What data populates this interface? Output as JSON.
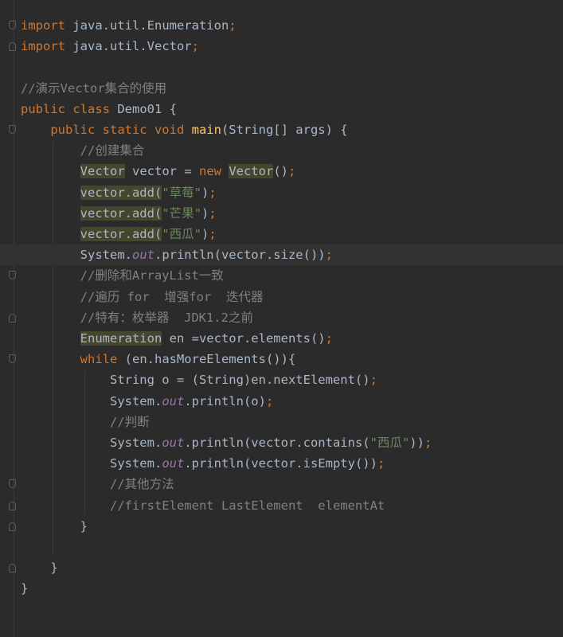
{
  "editor": {
    "language": "java",
    "current_line": 12,
    "colors": {
      "background": "#2b2b2b",
      "current_line": "#323232",
      "keyword": "#cc7832",
      "comment": "#808080",
      "string": "#6a8759",
      "method_declaration": "#ffc66d",
      "static_field": "#9876aa",
      "default_text": "#a9b7c6",
      "highlighted_usage": "#4a4a33"
    },
    "lines": [
      {
        "n": 1,
        "fold": "open",
        "tokens": [
          {
            "t": "kw",
            "v": "import"
          },
          {
            "t": "plain",
            "v": " java.util.Enumeration"
          },
          {
            "t": "kw",
            "v": ";"
          }
        ]
      },
      {
        "n": 2,
        "fold": "close",
        "tokens": [
          {
            "t": "kw",
            "v": "import"
          },
          {
            "t": "plain",
            "v": " java.util.Vector"
          },
          {
            "t": "kw",
            "v": ";"
          }
        ]
      },
      {
        "n": 3,
        "fold": "",
        "tokens": []
      },
      {
        "n": 4,
        "fold": "",
        "tokens": [
          {
            "t": "cmt",
            "v": "//演示Vector集合的使用"
          }
        ]
      },
      {
        "n": 5,
        "fold": "",
        "tokens": [
          {
            "t": "kw",
            "v": "public class "
          },
          {
            "t": "plain",
            "v": "Demo01 {"
          }
        ]
      },
      {
        "n": 6,
        "fold": "open",
        "tokens": [
          {
            "t": "plain",
            "v": "    "
          },
          {
            "t": "kw",
            "v": "public static void "
          },
          {
            "t": "fn",
            "v": "main"
          },
          {
            "t": "plain",
            "v": "(String[] args) {"
          }
        ]
      },
      {
        "n": 7,
        "fold": "",
        "tokens": [
          {
            "t": "plain",
            "v": "        "
          },
          {
            "t": "cmt",
            "v": "//创建集合"
          }
        ]
      },
      {
        "n": 8,
        "fold": "",
        "tokens": [
          {
            "t": "plain",
            "v": "        "
          },
          {
            "t": "hl",
            "v": "Vector"
          },
          {
            "t": "plain",
            "v": " vector = "
          },
          {
            "t": "kw",
            "v": "new "
          },
          {
            "t": "hl",
            "v": "Vector"
          },
          {
            "t": "plain",
            "v": "()"
          },
          {
            "t": "kw",
            "v": ";"
          }
        ]
      },
      {
        "n": 9,
        "fold": "",
        "tokens": [
          {
            "t": "plain",
            "v": "        "
          },
          {
            "t": "hl",
            "v": "vector.add("
          },
          {
            "t": "str",
            "v": "\"草莓\""
          },
          {
            "t": "plain",
            "v": ")"
          },
          {
            "t": "kw",
            "v": ";"
          }
        ]
      },
      {
        "n": 10,
        "fold": "",
        "tokens": [
          {
            "t": "plain",
            "v": "        "
          },
          {
            "t": "hl",
            "v": "vector.add("
          },
          {
            "t": "str",
            "v": "\"芒果\""
          },
          {
            "t": "plain",
            "v": ")"
          },
          {
            "t": "kw",
            "v": ";"
          }
        ]
      },
      {
        "n": 11,
        "fold": "",
        "tokens": [
          {
            "t": "plain",
            "v": "        "
          },
          {
            "t": "hl",
            "v": "vector.add("
          },
          {
            "t": "str",
            "v": "\"西瓜\""
          },
          {
            "t": "plain",
            "v": ")"
          },
          {
            "t": "kw",
            "v": ";"
          }
        ]
      },
      {
        "n": 12,
        "fold": "",
        "tokens": [
          {
            "t": "plain",
            "v": "        System."
          },
          {
            "t": "static",
            "v": "out"
          },
          {
            "t": "plain",
            "v": ".println(vector.size())"
          },
          {
            "t": "kw",
            "v": ";"
          }
        ]
      },
      {
        "n": 13,
        "fold": "open",
        "tokens": [
          {
            "t": "plain",
            "v": "        "
          },
          {
            "t": "cmt",
            "v": "//删除和ArrayList一致"
          }
        ]
      },
      {
        "n": 14,
        "fold": "",
        "tokens": [
          {
            "t": "plain",
            "v": "        "
          },
          {
            "t": "cmt",
            "v": "//遍历 for  增强for  迭代器"
          }
        ]
      },
      {
        "n": 15,
        "fold": "close",
        "tokens": [
          {
            "t": "plain",
            "v": "        "
          },
          {
            "t": "cmt",
            "v": "//特有：枚举器  JDK1.2之前"
          }
        ]
      },
      {
        "n": 16,
        "fold": "",
        "tokens": [
          {
            "t": "plain",
            "v": "        "
          },
          {
            "t": "hl",
            "v": "Enumeration"
          },
          {
            "t": "plain",
            "v": " en =vector.elements()"
          },
          {
            "t": "kw",
            "v": ";"
          }
        ]
      },
      {
        "n": 17,
        "fold": "open",
        "tokens": [
          {
            "t": "plain",
            "v": "        "
          },
          {
            "t": "kw",
            "v": "while "
          },
          {
            "t": "plain",
            "v": "(en.hasMoreElements()){"
          }
        ]
      },
      {
        "n": 18,
        "fold": "",
        "tokens": [
          {
            "t": "plain",
            "v": "            String o = (String)en.nextElement()"
          },
          {
            "t": "kw",
            "v": ";"
          }
        ]
      },
      {
        "n": 19,
        "fold": "",
        "tokens": [
          {
            "t": "plain",
            "v": "            System."
          },
          {
            "t": "static",
            "v": "out"
          },
          {
            "t": "plain",
            "v": ".println(o)"
          },
          {
            "t": "kw",
            "v": ";"
          }
        ]
      },
      {
        "n": 20,
        "fold": "",
        "tokens": [
          {
            "t": "plain",
            "v": "            "
          },
          {
            "t": "cmt",
            "v": "//判断"
          }
        ]
      },
      {
        "n": 21,
        "fold": "",
        "tokens": [
          {
            "t": "plain",
            "v": "            System."
          },
          {
            "t": "static",
            "v": "out"
          },
          {
            "t": "plain",
            "v": ".println(vector.contains("
          },
          {
            "t": "str",
            "v": "\"西瓜\""
          },
          {
            "t": "plain",
            "v": "))"
          },
          {
            "t": "kw",
            "v": ";"
          }
        ]
      },
      {
        "n": 22,
        "fold": "",
        "tokens": [
          {
            "t": "plain",
            "v": "            System."
          },
          {
            "t": "static",
            "v": "out"
          },
          {
            "t": "plain",
            "v": ".println(vector.isEmpty())"
          },
          {
            "t": "kw",
            "v": ";"
          }
        ]
      },
      {
        "n": 23,
        "fold": "open",
        "tokens": [
          {
            "t": "plain",
            "v": "            "
          },
          {
            "t": "cmt",
            "v": "//其他方法"
          }
        ]
      },
      {
        "n": 24,
        "fold": "close",
        "tokens": [
          {
            "t": "plain",
            "v": "            "
          },
          {
            "t": "cmt",
            "v": "//firstElement LastElement  elementAt"
          }
        ]
      },
      {
        "n": 25,
        "fold": "close",
        "tokens": [
          {
            "t": "plain",
            "v": "        }"
          }
        ]
      },
      {
        "n": 26,
        "fold": "",
        "tokens": []
      },
      {
        "n": 27,
        "fold": "close",
        "tokens": [
          {
            "t": "plain",
            "v": "    }"
          }
        ]
      },
      {
        "n": 28,
        "fold": "",
        "tokens": [
          {
            "t": "plain",
            "v": "}"
          }
        ]
      }
    ]
  }
}
